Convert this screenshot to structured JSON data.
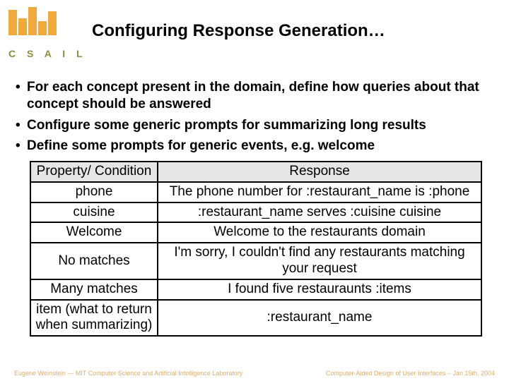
{
  "logo_text": "C S A I L",
  "title": "Configuring Response Generation…",
  "bullets": [
    "For each concept present in the domain, define how queries about that concept should be answered",
    "Configure some generic prompts for summarizing long results",
    "Define some prompts for generic events, e.g. welcome"
  ],
  "table": {
    "headers": [
      "Property/ Condition",
      "Response"
    ],
    "rows": [
      [
        "phone",
        "The phone number for :restaurant_name is :phone"
      ],
      [
        "cuisine",
        ":restaurant_name serves :cuisine cuisine"
      ],
      [
        "Welcome",
        "Welcome to the restaurants domain"
      ],
      [
        "No matches",
        "I'm sorry, I couldn't find any restaurants matching your request"
      ],
      [
        "Many matches",
        "I found five restauraunts :items"
      ],
      [
        "item (what to return when summarizing)",
        ":restaurant_name"
      ]
    ]
  },
  "footer_left": "Eugene Weinstein — MIT Computer Science and Artificial Intelligence Laboratory",
  "footer_right": "Computer-Aided Design of User Interfaces – Jan 15th, 2004"
}
